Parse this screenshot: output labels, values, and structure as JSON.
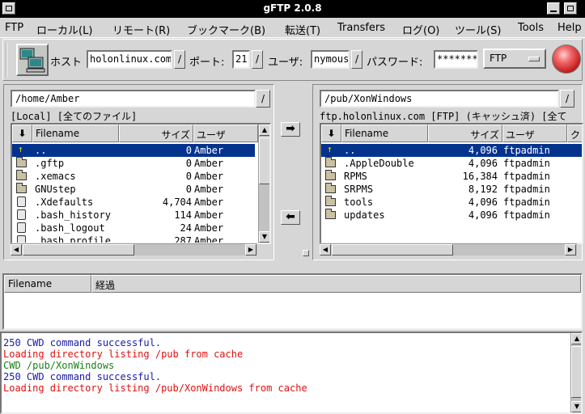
{
  "window": {
    "title": "gFTP 2.0.8"
  },
  "menu": [
    "FTP",
    "ローカル(L)",
    "リモート(R)",
    "ブックマーク(B)",
    "転送(T)",
    "Transfers",
    "ログ(O)",
    "ツール(S)",
    "Tools",
    "Help"
  ],
  "toolbar": {
    "host_label": "ホスト",
    "host_value": "holonlinux.com",
    "port_label": "ポート:",
    "port_value": "21",
    "user_label": "ユーザ:",
    "user_value": "nymous",
    "pass_label": "パスワード:",
    "pass_value": "*******",
    "protocol": "FTP"
  },
  "local": {
    "path": "/home/Amber",
    "status": "[Local] [全てのファイル]",
    "headers": [
      "Filename",
      "サイズ",
      "ユーザ"
    ],
    "files": [
      {
        "name": "..",
        "size": "0",
        "user": "Amber",
        "icon": "up-arrow-icon",
        "selected": true
      },
      {
        "name": ".gftp",
        "size": "0",
        "user": "Amber",
        "icon": "folder-icon"
      },
      {
        "name": ".xemacs",
        "size": "0",
        "user": "Amber",
        "icon": "folder-icon"
      },
      {
        "name": "GNUstep",
        "size": "0",
        "user": "Amber",
        "icon": "folder-icon"
      },
      {
        "name": ".Xdefaults",
        "size": "4,704",
        "user": "Amber",
        "icon": "file-icon"
      },
      {
        "name": ".bash_history",
        "size": "114",
        "user": "Amber",
        "icon": "file-icon"
      },
      {
        "name": ".bash_logout",
        "size": "24",
        "user": "Amber",
        "icon": "file-icon"
      },
      {
        "name": ".bash_profile",
        "size": "287",
        "user": "Amber",
        "icon": "file-icon"
      }
    ]
  },
  "remote": {
    "path": "/pub/XonWindows",
    "status": "ftp.holonlinux.com [FTP] (キャッシュ済) [全て",
    "headers": [
      "Filename",
      "サイズ",
      "ユーザ",
      "ク"
    ],
    "files": [
      {
        "name": "..",
        "size": "4,096",
        "user": "ftpadmin",
        "icon": "up-arrow-icon",
        "selected": true
      },
      {
        "name": ".AppleDouble",
        "size": "4,096",
        "user": "ftpadmin",
        "icon": "folder-icon"
      },
      {
        "name": "RPMS",
        "size": "16,384",
        "user": "ftpadmin",
        "icon": "folder-icon"
      },
      {
        "name": "SRPMS",
        "size": "8,192",
        "user": "ftpadmin",
        "icon": "folder-icon"
      },
      {
        "name": "tools",
        "size": "4,096",
        "user": "ftpadmin",
        "icon": "folder-icon"
      },
      {
        "name": "updates",
        "size": "4,096",
        "user": "ftpadmin",
        "icon": "folder-icon"
      }
    ]
  },
  "transfer": {
    "right_arrow": "➡",
    "left_arrow": "⬅"
  },
  "queue": {
    "headers": [
      "Filename",
      "経過"
    ]
  },
  "log": [
    {
      "text": "250 CWD command successful.",
      "color": "#1a1aa8"
    },
    {
      "text": "Loading directory listing /pub from cache",
      "color": "#e01010"
    },
    {
      "text": "CWD /pub/XonWindows",
      "color": "#188018"
    },
    {
      "text": "250 CWD command successful.",
      "color": "#1a1aa8"
    },
    {
      "text": "Loading directory listing /pub/XonWindows from cache",
      "color": "#e01010"
    }
  ]
}
